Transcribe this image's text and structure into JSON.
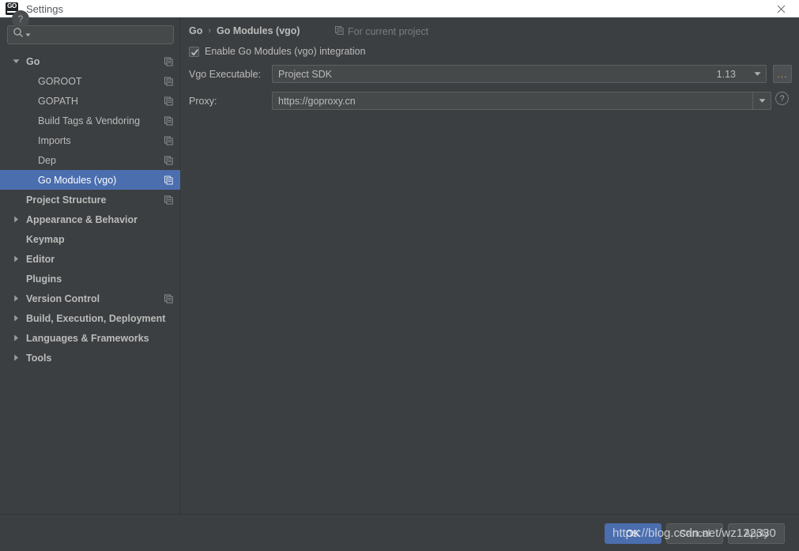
{
  "window": {
    "title": "Settings",
    "app_icon": "goland-icon",
    "close_icon": "close-icon"
  },
  "search": {
    "placeholder": "",
    "value": "",
    "icon": "search-icon",
    "dropdown_icon": "chevron-down-icon"
  },
  "sidebar": {
    "items": [
      {
        "label": "Go",
        "indent": 0,
        "bold": true,
        "arrow": "expanded",
        "project_icon": true,
        "selected": false
      },
      {
        "label": "GOROOT",
        "indent": 1,
        "bold": false,
        "arrow": "none",
        "project_icon": true,
        "selected": false
      },
      {
        "label": "GOPATH",
        "indent": 1,
        "bold": false,
        "arrow": "none",
        "project_icon": true,
        "selected": false
      },
      {
        "label": "Build Tags & Vendoring",
        "indent": 1,
        "bold": false,
        "arrow": "none",
        "project_icon": true,
        "selected": false
      },
      {
        "label": "Imports",
        "indent": 1,
        "bold": false,
        "arrow": "none",
        "project_icon": true,
        "selected": false
      },
      {
        "label": "Dep",
        "indent": 1,
        "bold": false,
        "arrow": "none",
        "project_icon": true,
        "selected": false
      },
      {
        "label": "Go Modules (vgo)",
        "indent": 1,
        "bold": false,
        "arrow": "none",
        "project_icon": true,
        "selected": true
      },
      {
        "label": "Project Structure",
        "indent": 0,
        "bold": true,
        "arrow": "none",
        "project_icon": true,
        "selected": false
      },
      {
        "label": "Appearance & Behavior",
        "indent": 0,
        "bold": true,
        "arrow": "collapsed",
        "project_icon": false,
        "selected": false
      },
      {
        "label": "Keymap",
        "indent": 0,
        "bold": true,
        "arrow": "none",
        "project_icon": false,
        "selected": false
      },
      {
        "label": "Editor",
        "indent": 0,
        "bold": true,
        "arrow": "collapsed",
        "project_icon": false,
        "selected": false
      },
      {
        "label": "Plugins",
        "indent": 0,
        "bold": true,
        "arrow": "none",
        "project_icon": false,
        "selected": false
      },
      {
        "label": "Version Control",
        "indent": 0,
        "bold": true,
        "arrow": "collapsed",
        "project_icon": true,
        "selected": false
      },
      {
        "label": "Build, Execution, Deployment",
        "indent": 0,
        "bold": true,
        "arrow": "collapsed",
        "project_icon": false,
        "selected": false
      },
      {
        "label": "Languages & Frameworks",
        "indent": 0,
        "bold": true,
        "arrow": "collapsed",
        "project_icon": false,
        "selected": false
      },
      {
        "label": "Tools",
        "indent": 0,
        "bold": true,
        "arrow": "collapsed",
        "project_icon": false,
        "selected": false
      }
    ]
  },
  "main": {
    "breadcrumb": {
      "root": "Go",
      "separator": "›",
      "current": "Go Modules (vgo)"
    },
    "for_current_project": {
      "label": "For current project",
      "icon": "project-scope-icon"
    },
    "enable_checkbox": {
      "label": "Enable Go Modules (vgo) integration",
      "checked": true
    },
    "vgo_executable": {
      "label": "Vgo Executable:",
      "value": "Project SDK",
      "version": "1.13",
      "dropdown_icon": "chevron-down-icon",
      "browse_label": "...",
      "browse_icon": "ellipsis-icon"
    },
    "proxy": {
      "label": "Proxy:",
      "value": "https://goproxy.cn",
      "dropdown_icon": "chevron-down-icon",
      "help_icon": "question-mark-icon"
    }
  },
  "footer": {
    "help_label": "?",
    "help_icon": "question-mark-icon",
    "ok_label": "OK",
    "cancel_label": "Cancel",
    "apply_label": "Apply"
  },
  "watermark": {
    "text": "https://blog.csdn.net/wz122330"
  },
  "colors": {
    "background": "#3c3f41",
    "selection": "#4b6eaf",
    "field": "#45494a",
    "text": "#bbbbbb",
    "titlebar": "#ffffff"
  }
}
